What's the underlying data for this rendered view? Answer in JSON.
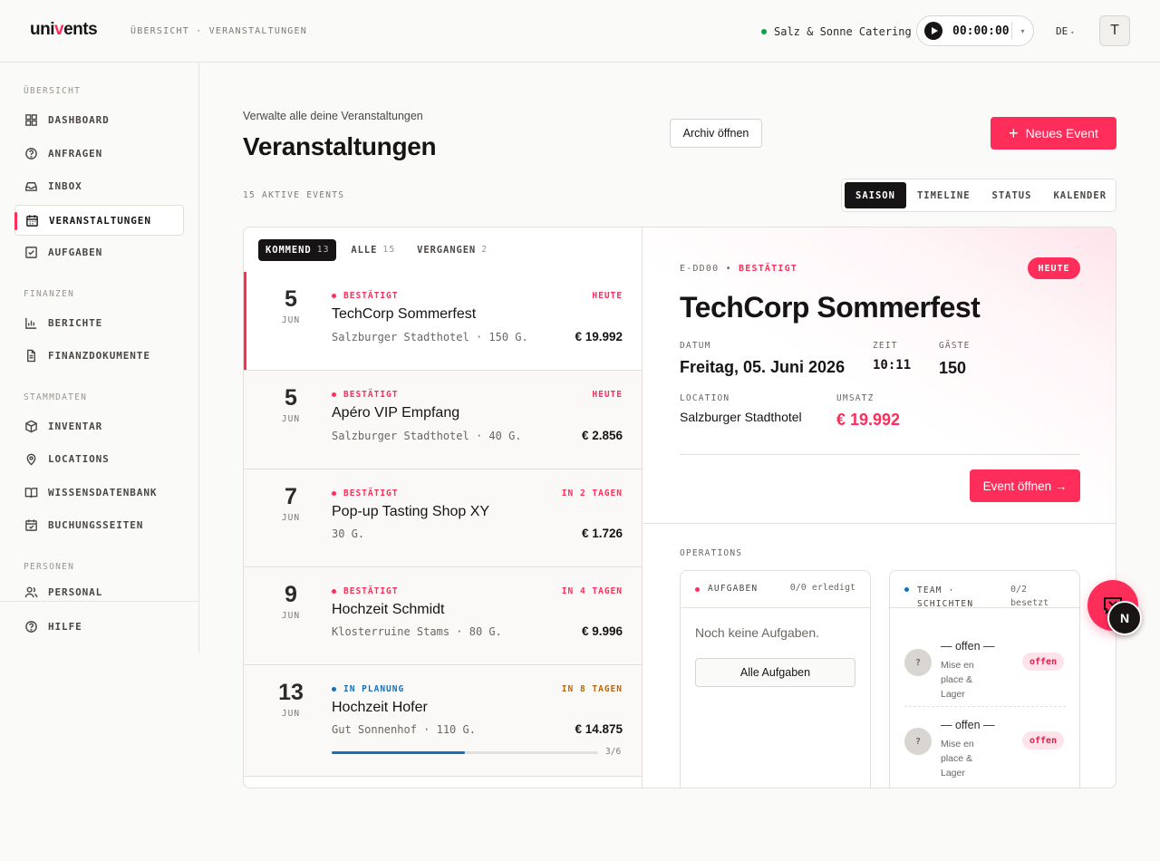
{
  "header": {
    "logo_pre": "uni",
    "logo_v": "v",
    "logo_post": "ents",
    "breadcrumb": "ÜBERSICHT · VERANSTALTUNGEN",
    "company": "Salz & Sonne Catering",
    "timer": "00:00:00",
    "timer_caret": "▾",
    "language": "DE",
    "language_caret": "▾",
    "user_initial": "T"
  },
  "sidebar": {
    "sections": {
      "overview": "ÜBERSICHT",
      "finance": "FINANZEN",
      "master": "STAMMDATEN",
      "people": "PERSONEN"
    },
    "items": {
      "dashboard": "DASHBOARD",
      "requests": "ANFRAGEN",
      "inbox": "INBOX",
      "events": "VERANSTALTUNGEN",
      "tasks": "AUFGABEN",
      "reports": "BERICHTE",
      "finance_docs": "FINANZDOKUMENTE",
      "inventory": "INVENTAR",
      "locations": "LOCATIONS",
      "knowledge": "WISSENSDATENBANK",
      "booking": "BUCHUNGSSEITEN",
      "staff": "PERSONAL",
      "help": "HILFE"
    }
  },
  "main": {
    "subtitle": "Verwalte alle deine Veranstaltungen",
    "title": "Veranstaltungen",
    "archive_button": "Archiv öffnen",
    "new_button": "Neues Event",
    "new_button_icon": "+",
    "active_count": "15 AKTIVE EVENTS",
    "view_tabs": [
      "SAISON",
      "TIMELINE",
      "STATUS",
      "KALENDER"
    ]
  },
  "list": {
    "tabs": [
      {
        "label": "KOMMEND",
        "count": "13"
      },
      {
        "label": "ALLE",
        "count": "15"
      },
      {
        "label": "VERGANGEN",
        "count": "2"
      }
    ],
    "events": [
      {
        "day": "5",
        "month": "JUN",
        "status": "BESTÄTIGT",
        "when": "HEUTE",
        "name": "TechCorp Sommerfest",
        "meta": "Salzburger Stadthotel · 150 G.",
        "amount": "€ 19.992"
      },
      {
        "day": "5",
        "month": "JUN",
        "status": "BESTÄTIGT",
        "when": "HEUTE",
        "name": "Apéro VIP Empfang",
        "meta": "Salzburger Stadthotel · 40 G.",
        "amount": "€ 2.856"
      },
      {
        "day": "7",
        "month": "JUN",
        "status": "BESTÄTIGT",
        "when": "IN 2 TAGEN",
        "name": "Pop-up Tasting Shop XY",
        "meta": "30 G.",
        "amount": "€ 1.726"
      },
      {
        "day": "9",
        "month": "JUN",
        "status": "BESTÄTIGT",
        "when": "IN 4 TAGEN",
        "name": "Hochzeit Schmidt",
        "meta": "Klosterruine Stams · 80 G.",
        "amount": "€ 9.996"
      },
      {
        "day": "13",
        "month": "JUN",
        "status": "IN PLANUNG",
        "when": "IN 8 TAGEN",
        "name": "Hochzeit Hofer",
        "meta": "Gut Sonnenhof · 110 G.",
        "amount": "€ 14.875",
        "progress_label": "3/6",
        "progress_fraction": 0.5
      }
    ]
  },
  "detail": {
    "id": "E-DD00",
    "separator": "•",
    "status": "BESTÄTIGT",
    "badge": "HEUTE",
    "title": "TechCorp Sommerfest",
    "date_label": "DATUM",
    "date": "Freitag, 05. Juni 2026",
    "time_label": "ZEIT",
    "time": "10:11",
    "guests_label": "GÄSTE",
    "guests": "150",
    "location_label": "LOCATION",
    "location": "Salzburger Stadthotel",
    "revenue_label": "UMSATZ",
    "revenue": "€ 19.992",
    "open_button": "Event öffnen →"
  },
  "operations": {
    "label": "OPERATIONS",
    "tasks": {
      "title": "AUFGABEN",
      "count": "0/0 erledigt",
      "empty": "Noch keine Aufgaben.",
      "button": "Alle Aufgaben"
    },
    "team": {
      "title_line1": "TEAM ·",
      "title_line2": "SCHICHTEN",
      "count_line1": "0/2",
      "count_line2": "besetzt",
      "shifts": [
        {
          "avatar": "?",
          "name": "— offen —",
          "role": "Mise en place & Lager",
          "badge": "offen"
        },
        {
          "avatar": "?",
          "name": "— offen —",
          "role": "Mise en place & Lager",
          "badge": "offen"
        }
      ]
    }
  },
  "floating": {
    "assistant_initial": "N"
  },
  "colors": {
    "accent": "#ff2d5a",
    "confirmed": "#ff2d5a",
    "planning": "#1670b8",
    "soon": "#b8660c",
    "online": "#10a04a"
  }
}
